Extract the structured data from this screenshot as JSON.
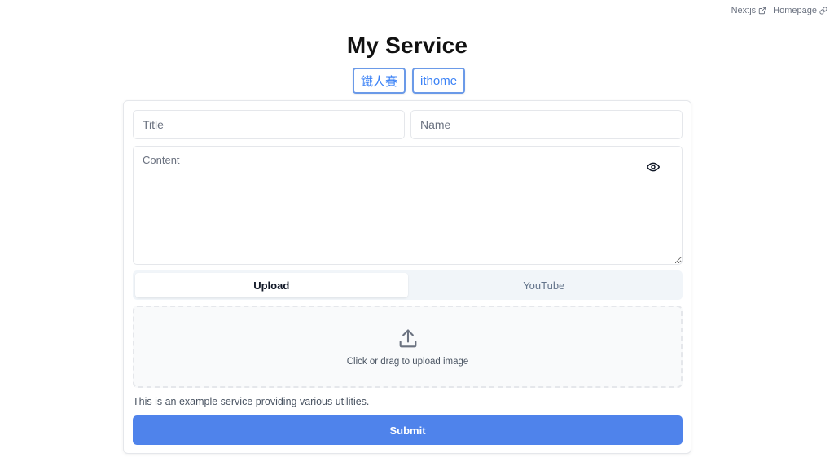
{
  "top_links": [
    {
      "label": "Nextjs",
      "icon": "external-link-icon"
    },
    {
      "label": "Homepage",
      "icon": "link-icon"
    }
  ],
  "title": "My Service",
  "tags": [
    "鐵人賽",
    "ithome"
  ],
  "form": {
    "title_placeholder": "Title",
    "name_placeholder": "Name",
    "content_placeholder": "Content",
    "preview_icon": "eye-icon",
    "tabs": [
      {
        "label": "Upload",
        "active": true
      },
      {
        "label": "YouTube",
        "active": false
      }
    ],
    "upload_icon": "upload-icon",
    "upload_text": "Click or drag to upload image",
    "description": "This is an example service providing various utilities.",
    "submit_label": "Submit"
  },
  "colors": {
    "accent": "#4f83eb",
    "tag_border": "#6b9ae8",
    "tag_text": "#3b82f6"
  }
}
